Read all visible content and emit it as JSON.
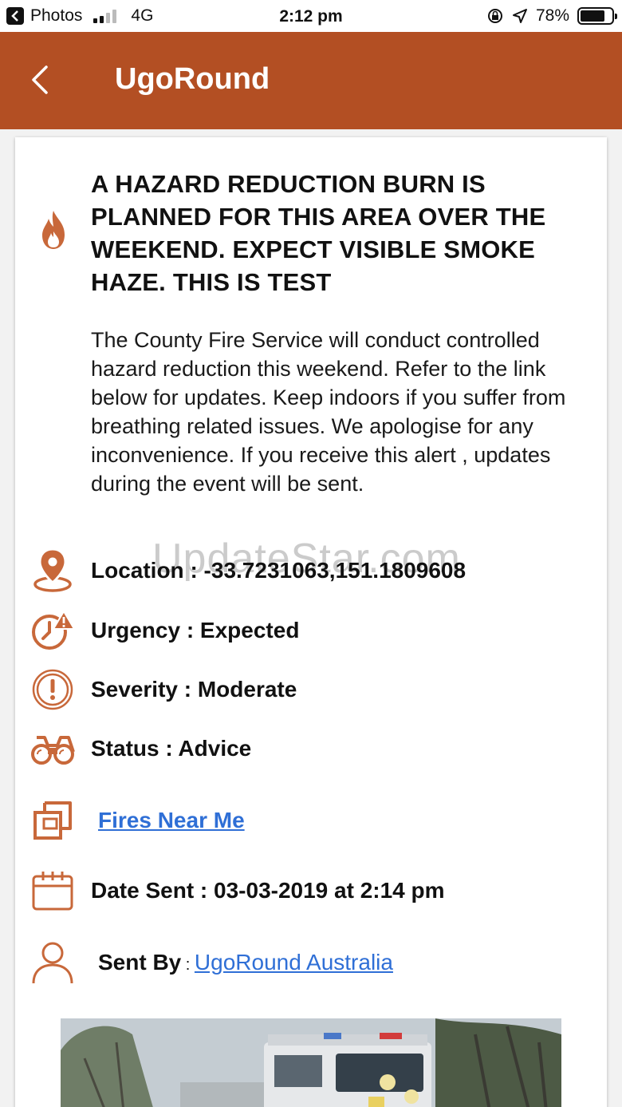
{
  "status_bar": {
    "back_app": "Photos",
    "network": "4G",
    "time": "2:12 pm",
    "battery": "78%",
    "battery_level": 0.78
  },
  "nav": {
    "title": "UgoRound"
  },
  "alert": {
    "headline": "A HAZARD REDUCTION BURN IS PLANNED FOR THIS AREA OVER THE WEEKEND. EXPECT VISIBLE SMOKE HAZE. THIS IS TEST",
    "description": "The County Fire Service will conduct controlled hazard reduction this weekend. Refer to the link below for updates. Keep indoors if you suffer from breathing related issues. We apologise for any inconvenience. If you receive this alert , updates during the event will be sent.",
    "location": "Location : -33.7231063,151.1809608",
    "urgency": "Urgency : Expected",
    "severity": "Severity : Moderate",
    "status": "Status : Advice",
    "link_label": "Fires Near Me",
    "date_sent": "Date Sent : 03-03-2019 at 2:14 pm",
    "sent_by_label": "Sent By",
    "sent_by_sep": " : ",
    "sent_by_value": "UgoRound Australia"
  },
  "watermark": "UpdateStar.com",
  "colors": {
    "brand": "#b34f23",
    "icon": "#c8683a",
    "link": "#2f6fd6"
  },
  "icons": [
    "fire-icon",
    "location-pin-icon",
    "urgency-clock-icon",
    "severity-alert-icon",
    "binoculars-icon",
    "external-link-icon",
    "calendar-icon",
    "person-icon"
  ]
}
